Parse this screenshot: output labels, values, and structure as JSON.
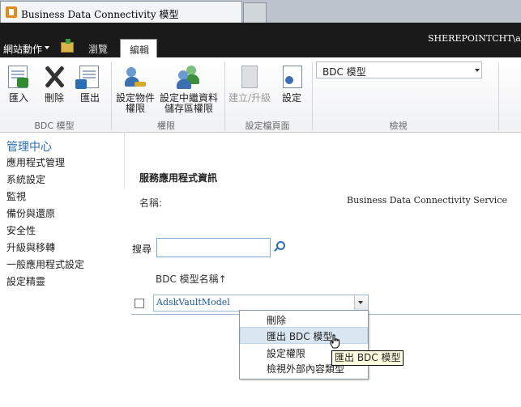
{
  "browser": {
    "tab_title": "Business Data Connectivity 模型"
  },
  "topbar": {
    "site_actions": "網站動作",
    "tabs": [
      {
        "label": "瀏覽"
      },
      {
        "label": "編輯"
      }
    ],
    "user": "SHEREPOINTCHT\\adm"
  },
  "ribbon": {
    "groups": [
      {
        "label": "BDC 模型",
        "buttons": [
          "匯入",
          "刪除",
          "匯出"
        ]
      },
      {
        "label": "權限",
        "buttons": [
          [
            "設定物件",
            "權限"
          ],
          [
            "設定中繼資料",
            "儲存區權限"
          ]
        ]
      },
      {
        "label": "設定檔頁面",
        "buttons": [
          "建立/升級",
          "設定"
        ]
      },
      {
        "label": "檢視"
      }
    ],
    "view_dropdown": "BDC 模型"
  },
  "sidebar": {
    "title": "管理中心",
    "items": [
      "應用程式管理",
      "系統設定",
      "監視",
      "備份與還原",
      "安全性",
      "升級與移轉",
      "一般應用程式設定",
      "設定精靈"
    ]
  },
  "content": {
    "section_title": "服務應用程式資訊",
    "name_label": "名稱:",
    "name_value": "Business Data Connectivity Service",
    "search_label": "搜尋",
    "search_value": "",
    "column_header": "BDC 模型名稱↑",
    "rows": [
      {
        "name": "AdskVaultModel"
      }
    ]
  },
  "context_menu": {
    "items": [
      "刪除",
      "匯出 BDC 模型",
      "設定權限",
      "檢視外部內容類型"
    ],
    "highlighted": "匯出 BDC 模型"
  },
  "tooltip": "匯出 BDC 模型"
}
